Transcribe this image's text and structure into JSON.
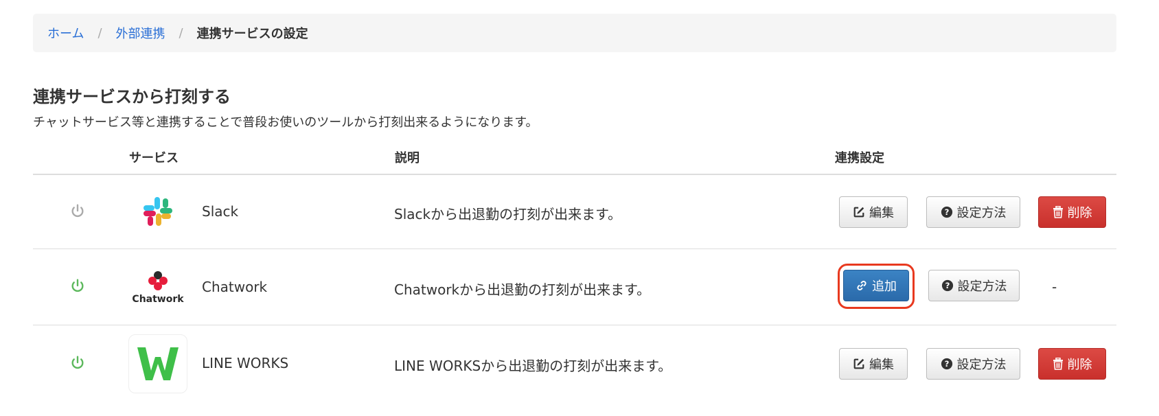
{
  "breadcrumb": {
    "home": "ホーム",
    "integrations": "外部連携",
    "current": "連携サービスの設定",
    "separator": "/"
  },
  "page": {
    "title": "連携サービスから打刻する",
    "description": "チャットサービス等と連携することで普段お使いのツールから打刻出来るようになります。"
  },
  "table": {
    "headers": {
      "service": "サービス",
      "description": "説明",
      "settings": "連携設定"
    },
    "rows": [
      {
        "power_icon": "power-icon",
        "power_color": "#aaaaaa",
        "logo": "slack-logo",
        "name": "Slack",
        "description": "Slackから出退勤の打刻が出来ます。",
        "edit_label": "編集",
        "howto_label": "設定方法",
        "delete_label": "削除"
      },
      {
        "power_icon": "power-icon",
        "power_color": "#5cb85c",
        "logo": "chatwork-logo",
        "logo_text": "Chatwork",
        "name": "Chatwork",
        "description": "Chatworkから出退勤の打刻が出来ます。",
        "add_label": "追加",
        "howto_label": "設定方法",
        "empty": "-"
      },
      {
        "power_icon": "power-icon",
        "power_color": "#5cb85c",
        "logo": "line-works-logo",
        "name": "LINE WORKS",
        "description": "LINE WORKSから出退勤の打刻が出来ます。",
        "edit_label": "編集",
        "howto_label": "設定方法",
        "delete_label": "削除"
      }
    ]
  },
  "colors": {
    "link": "#2a6fd6",
    "primary": "#2a6aaa",
    "danger": "#c9302c",
    "highlight": "#e8391f",
    "active": "#5cb85c",
    "inactive": "#aaaaaa"
  }
}
